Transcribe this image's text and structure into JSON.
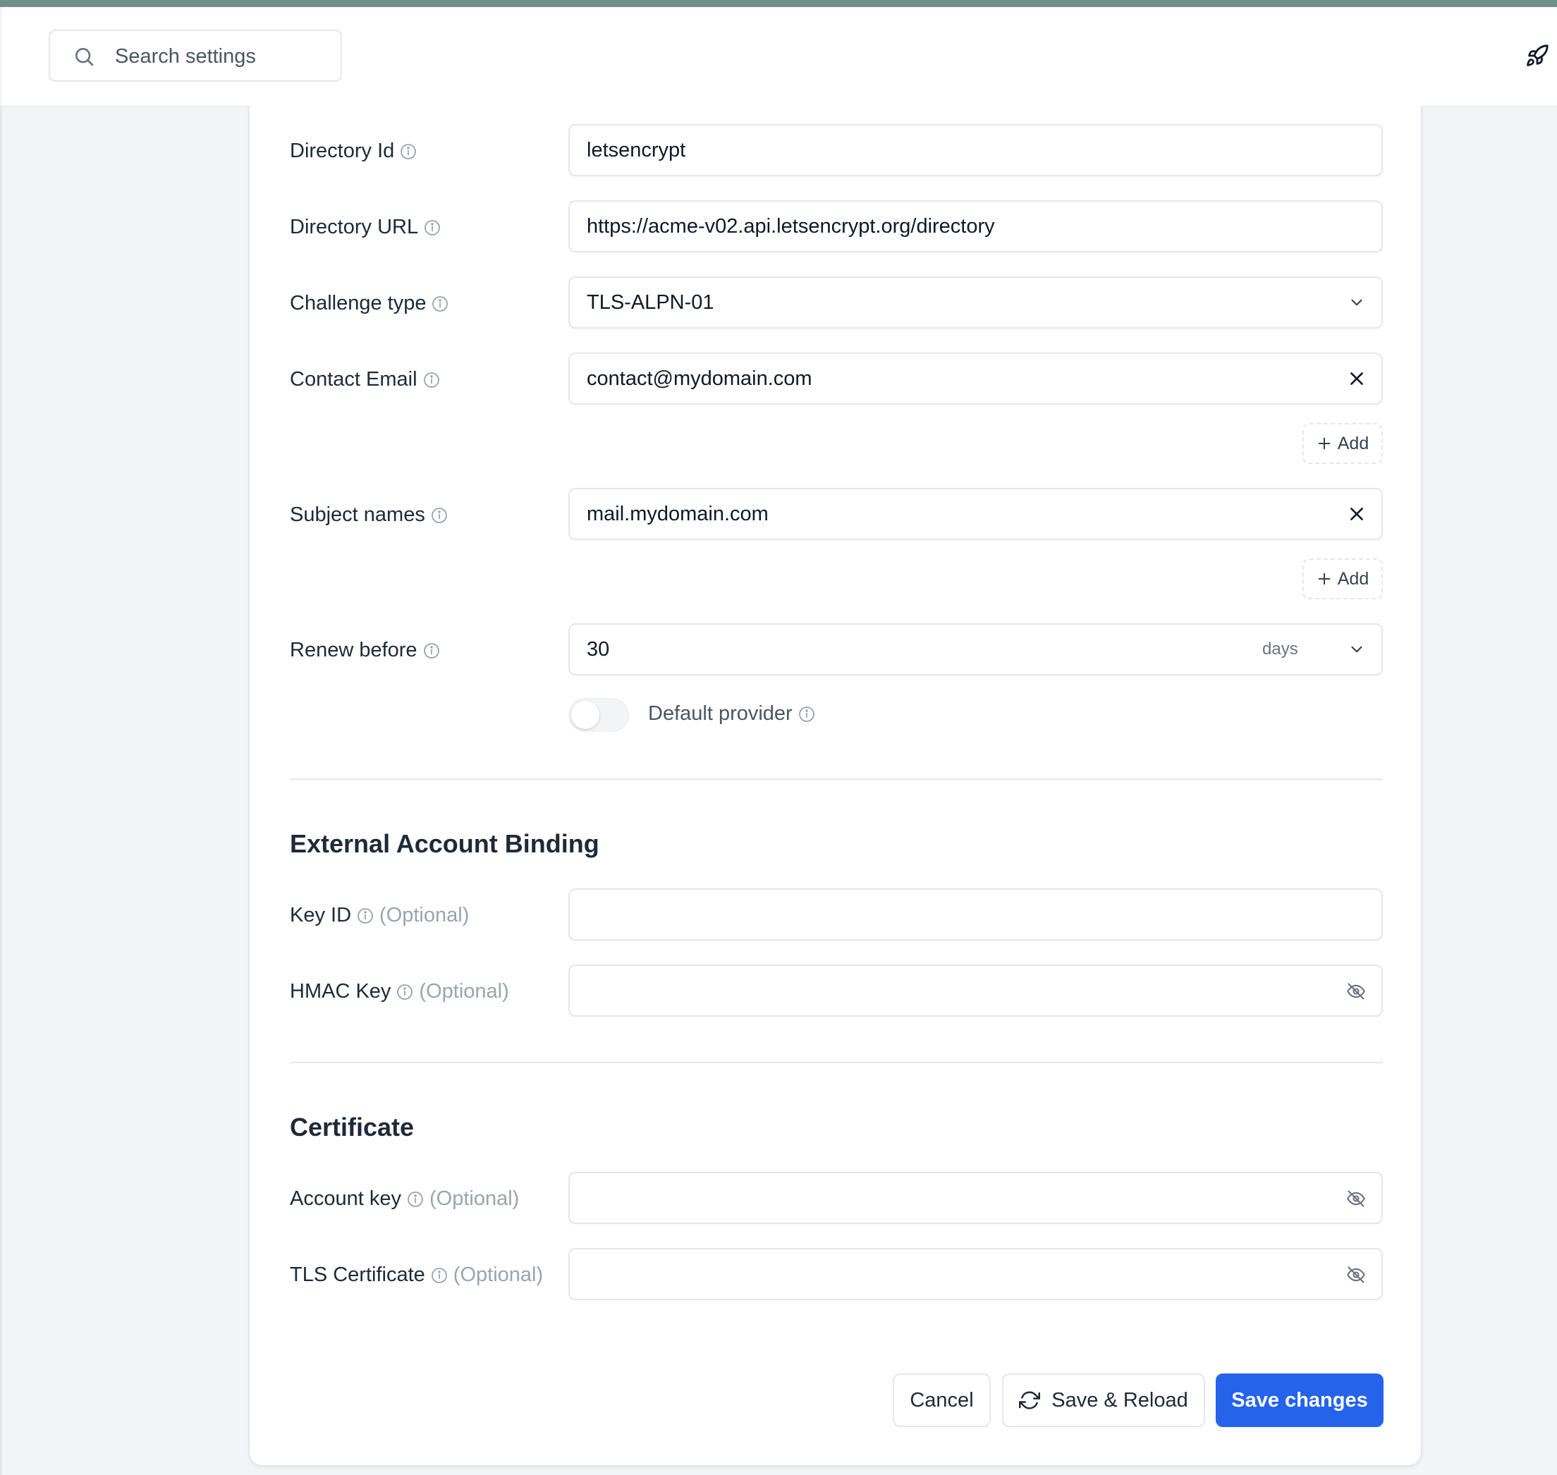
{
  "header": {
    "search_placeholder": "Search settings"
  },
  "form": {
    "directory_id": {
      "label": "Directory Id",
      "value": "letsencrypt"
    },
    "directory_url": {
      "label": "Directory URL",
      "value": "https://acme-v02.api.letsencrypt.org/directory"
    },
    "challenge_type": {
      "label": "Challenge type",
      "value": "TLS-ALPN-01"
    },
    "contact_email": {
      "label": "Contact Email",
      "value": "contact@mydomain.com",
      "add_label": "Add"
    },
    "subject_names": {
      "label": "Subject names",
      "value": "mail.mydomain.com",
      "add_label": "Add"
    },
    "renew_before": {
      "label": "Renew before",
      "value": "30",
      "unit": "days"
    },
    "default_provider": {
      "label": "Default provider",
      "enabled": false
    }
  },
  "eab": {
    "title": "External Account Binding",
    "key_id": {
      "label": "Key ID",
      "optional": "(Optional)"
    },
    "hmac_key": {
      "label": "HMAC Key",
      "optional": "(Optional)"
    }
  },
  "certificate": {
    "title": "Certificate",
    "account_key": {
      "label": "Account key",
      "optional": "(Optional)"
    },
    "tls_certificate": {
      "label": "TLS Certificate",
      "optional": "(Optional)"
    }
  },
  "actions": {
    "cancel": "Cancel",
    "save_reload": "Save & Reload",
    "save": "Save changes"
  },
  "colors": {
    "primary": "#2563eb",
    "top_strip": "#6f9189"
  }
}
